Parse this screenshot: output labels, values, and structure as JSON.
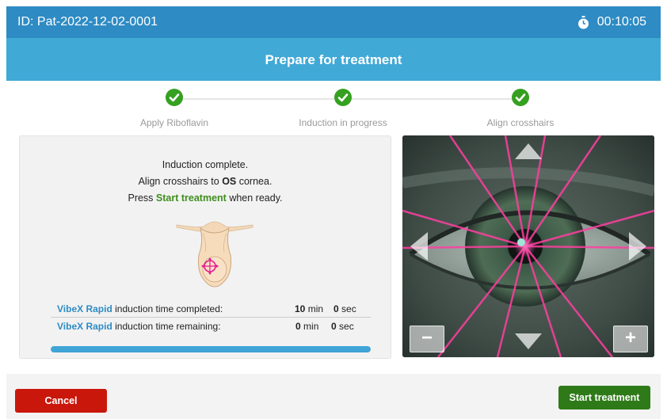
{
  "header": {
    "patient_id": "ID: Pat-2022-12-02-0001",
    "timer": "00:10:05"
  },
  "title": "Prepare for treatment",
  "steps": [
    {
      "label": "Apply Riboflavin"
    },
    {
      "label": "Induction in progress"
    },
    {
      "label": "Align crosshairs"
    }
  ],
  "instructions": {
    "line1": "Induction complete.",
    "line2_pre": "Align crosshairs to ",
    "line2_bold": "OS",
    "line2_post": " cornea.",
    "line3_pre": "Press ",
    "line3_green": "Start treatment",
    "line3_post": " when ready."
  },
  "induction": {
    "brand": "VibeX Rapid",
    "completed_label": " induction time completed:",
    "completed_min": "10",
    "completed_sec": "0",
    "remaining_label": " induction time remaining:",
    "remaining_min": "0",
    "remaining_sec": "0",
    "min_unit": "min",
    "sec_unit": "sec",
    "progress_fraction": 1.0
  },
  "camera": {
    "zoom_out": "−",
    "zoom_in": "+"
  },
  "buttons": {
    "cancel": "Cancel",
    "start": "Start treatment"
  },
  "colors": {
    "header": "#2e8bc4",
    "subheader": "#41a9d6",
    "check": "#36a021",
    "cancel": "#c9170c",
    "start": "#2e7a19",
    "laser": "#ff3fa0"
  }
}
